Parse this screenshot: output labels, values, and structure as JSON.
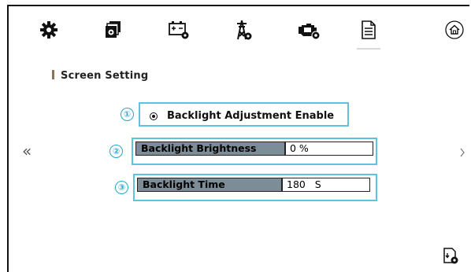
{
  "toolbar": {
    "icons": [
      "gear-icon",
      "module-settings-icon",
      "battery-settings-icon",
      "tower-settings-icon",
      "engine-settings-icon",
      "document-icon",
      "home-icon"
    ],
    "active_index": 5
  },
  "section": {
    "title": "Screen Setting"
  },
  "options": [
    {
      "number": "①",
      "label": "Backlight Adjustment Enable",
      "selected": true
    }
  ],
  "fields": [
    {
      "number": "②",
      "label": "Backlight Brightness",
      "value": "0 %"
    },
    {
      "number": "③",
      "label": "Backlight Time",
      "value": "180   S"
    }
  ],
  "navigation": {
    "prev_glyph": "«"
  },
  "colors": {
    "accent": "#5ec3dc",
    "label_fill": "#7d8d97",
    "title_bar": "#8b7355"
  }
}
